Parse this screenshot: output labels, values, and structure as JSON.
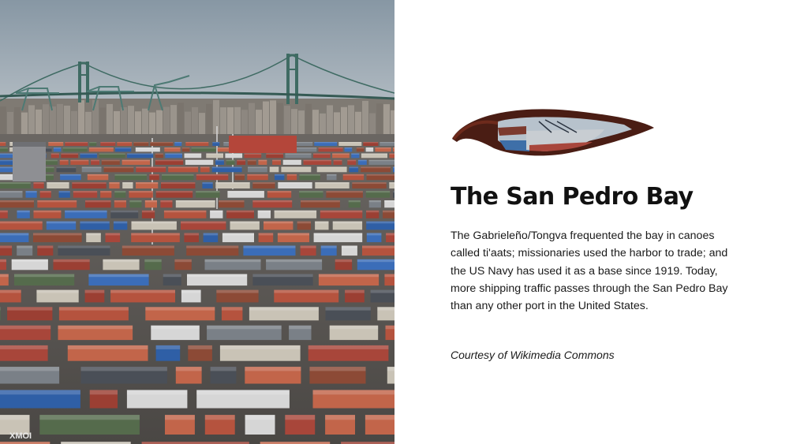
{
  "photo": {
    "subject": "port-container-yard-with-suspension-bridge",
    "container_label": "XMOI"
  },
  "illustration": {
    "icon": "canoe-icon"
  },
  "title": "The San Pedro Bay",
  "body": "The Gabrieleño/Tongva frequented the bay in canoes called ti'aats; missionaries used the harbor to trade; and the US Navy has used it as a base since 1919. Today, more shipping traffic passes through the San Pedro Bay than any other port in the United States.",
  "credit": "Courtesy of Wikimedia Commons",
  "colors": {
    "background": "#ffffff",
    "text": "#111111",
    "sky": "#9aa7b2"
  }
}
